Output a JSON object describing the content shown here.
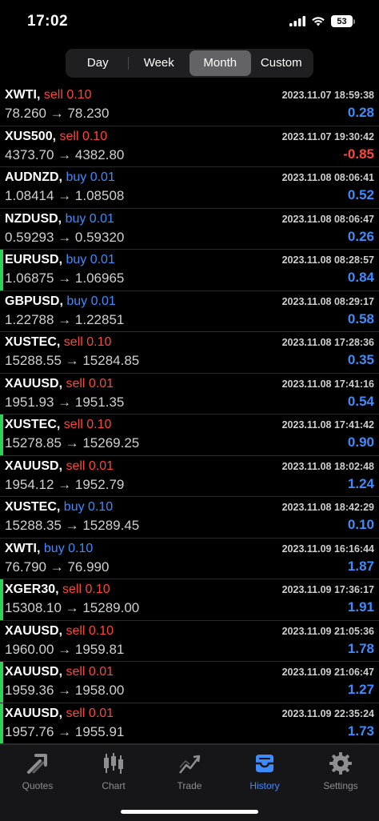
{
  "status": {
    "time": "17:02",
    "battery": "53"
  },
  "segments": [
    {
      "label": "Day"
    },
    {
      "label": "Week"
    },
    {
      "label": "Month"
    },
    {
      "label": "Custom"
    }
  ],
  "trades": [
    {
      "symbol": "XWTI,",
      "action": "sell 0.10",
      "side": "sell",
      "prices": "78.260 → 78.230",
      "datetime": "2023.11.07 18:59:38",
      "profit": "0.28",
      "marked": false
    },
    {
      "symbol": "XUS500,",
      "action": "sell 0.10",
      "side": "sell",
      "prices": "4373.70 → 4382.80",
      "datetime": "2023.11.07 19:30:42",
      "profit": "-0.85",
      "marked": false
    },
    {
      "symbol": "AUDNZD,",
      "action": "buy 0.01",
      "side": "buy",
      "prices": "1.08414 → 1.08508",
      "datetime": "2023.11.08 08:06:41",
      "profit": "0.52",
      "marked": false
    },
    {
      "symbol": "NZDUSD,",
      "action": "buy 0.01",
      "side": "buy",
      "prices": "0.59293 → 0.59320",
      "datetime": "2023.11.08 08:06:47",
      "profit": "0.26",
      "marked": false
    },
    {
      "symbol": "EURUSD,",
      "action": "buy 0.01",
      "side": "buy",
      "prices": "1.06875 → 1.06965",
      "datetime": "2023.11.08 08:28:57",
      "profit": "0.84",
      "marked": true
    },
    {
      "symbol": "GBPUSD,",
      "action": "buy 0.01",
      "side": "buy",
      "prices": "1.22788 → 1.22851",
      "datetime": "2023.11.08 08:29:17",
      "profit": "0.58",
      "marked": false
    },
    {
      "symbol": "XUSTEC,",
      "action": "sell 0.10",
      "side": "sell",
      "prices": "15288.55 → 15284.85",
      "datetime": "2023.11.08 17:28:36",
      "profit": "0.35",
      "marked": false
    },
    {
      "symbol": "XAUUSD,",
      "action": "sell 0.01",
      "side": "sell",
      "prices": "1951.93 → 1951.35",
      "datetime": "2023.11.08 17:41:16",
      "profit": "0.54",
      "marked": false
    },
    {
      "symbol": "XUSTEC,",
      "action": "sell 0.10",
      "side": "sell",
      "prices": "15278.85 → 15269.25",
      "datetime": "2023.11.08 17:41:42",
      "profit": "0.90",
      "marked": true
    },
    {
      "symbol": "XAUUSD,",
      "action": "sell 0.01",
      "side": "sell",
      "prices": "1954.12 → 1952.79",
      "datetime": "2023.11.08 18:02:48",
      "profit": "1.24",
      "marked": false
    },
    {
      "symbol": "XUSTEC,",
      "action": "buy 0.10",
      "side": "buy",
      "prices": "15288.35 → 15289.45",
      "datetime": "2023.11.08 18:42:29",
      "profit": "0.10",
      "marked": false
    },
    {
      "symbol": "XWTI,",
      "action": "buy 0.10",
      "side": "buy",
      "prices": "76.790 → 76.990",
      "datetime": "2023.11.09 16:16:44",
      "profit": "1.87",
      "marked": false
    },
    {
      "symbol": "XGER30,",
      "action": "sell 0.10",
      "side": "sell",
      "prices": "15308.10 → 15289.00",
      "datetime": "2023.11.09 17:36:17",
      "profit": "1.91",
      "marked": true
    },
    {
      "symbol": "XAUUSD,",
      "action": "sell 0.10",
      "side": "sell",
      "prices": "1960.00 → 1959.81",
      "datetime": "2023.11.09 21:05:36",
      "profit": "1.78",
      "marked": false
    },
    {
      "symbol": "XAUUSD,",
      "action": "sell 0.01",
      "side": "sell",
      "prices": "1959.36 → 1958.00",
      "datetime": "2023.11.09 21:06:47",
      "profit": "1.27",
      "marked": true
    },
    {
      "symbol": "XAUUSD,",
      "action": "sell 0.01",
      "side": "sell",
      "prices": "1957.76 → 1955.91",
      "datetime": "2023.11.09 22:35:24",
      "profit": "1.73",
      "marked": true
    }
  ],
  "tabs": [
    {
      "label": "Quotes",
      "icon": "quotes-icon"
    },
    {
      "label": "Chart",
      "icon": "chart-icon"
    },
    {
      "label": "Trade",
      "icon": "trade-icon"
    },
    {
      "label": "History",
      "icon": "history-icon"
    },
    {
      "label": "Settings",
      "icon": "settings-icon"
    }
  ],
  "colors": {
    "buy": "#3d8cff",
    "sell": "#ff453a",
    "marker": "#30d158",
    "active_tab": "#3d8cff"
  }
}
